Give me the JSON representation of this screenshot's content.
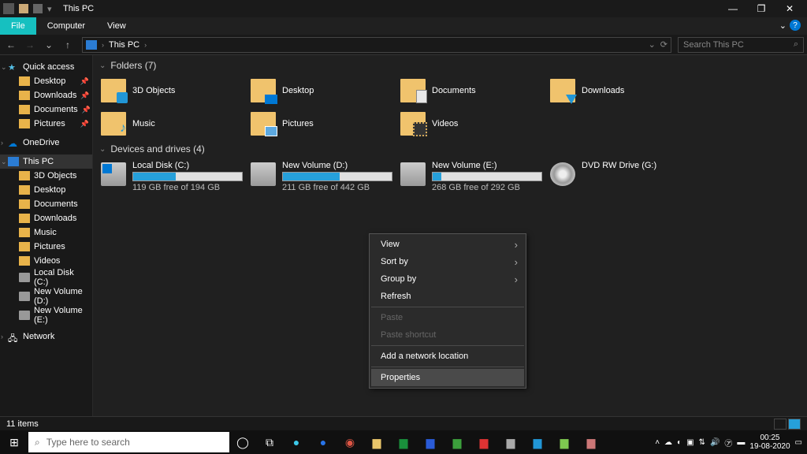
{
  "titlebar": {
    "title": "This PC",
    "min": "—",
    "max": "❐",
    "close": "✕"
  },
  "menubar": {
    "file": "File",
    "computer": "Computer",
    "view": "View",
    "help": "?",
    "expand": "⌄"
  },
  "navbar": {
    "back": "←",
    "forward": "→",
    "recent": "⌄",
    "up": "↑",
    "crumb_root": "This PC",
    "crumb_sep": "›",
    "refresh": "⟳",
    "addr_drop": "⌄",
    "search_placeholder": "Search This PC",
    "search_icon": "⌕"
  },
  "sidebar": {
    "quickaccess": "Quick access",
    "qa": [
      {
        "label": "Desktop",
        "pin": true
      },
      {
        "label": "Downloads",
        "pin": true
      },
      {
        "label": "Documents",
        "pin": true
      },
      {
        "label": "Pictures",
        "pin": true
      }
    ],
    "onedrive": "OneDrive",
    "thispc": "This PC",
    "pc": [
      {
        "label": "3D Objects"
      },
      {
        "label": "Desktop"
      },
      {
        "label": "Documents"
      },
      {
        "label": "Downloads"
      },
      {
        "label": "Music"
      },
      {
        "label": "Pictures"
      },
      {
        "label": "Videos"
      },
      {
        "label": "Local Disk (C:)"
      },
      {
        "label": "New Volume (D:)"
      },
      {
        "label": "New Volume (E:)"
      }
    ],
    "network": "Network"
  },
  "content": {
    "group_folders": "Folders (7)",
    "folders": [
      {
        "name": "3D Objects",
        "cls": "obj"
      },
      {
        "name": "Desktop",
        "cls": "desk"
      },
      {
        "name": "Documents",
        "cls": "docs"
      },
      {
        "name": "Downloads",
        "cls": "down"
      },
      {
        "name": "Music",
        "cls": "music"
      },
      {
        "name": "Pictures",
        "cls": "pics"
      },
      {
        "name": "Videos",
        "cls": "vids"
      }
    ],
    "group_drives": "Devices and drives (4)",
    "drives": [
      {
        "name": "Local Disk (C:)",
        "free": "119 GB free of 194 GB",
        "pct": 39,
        "cls": "win"
      },
      {
        "name": "New Volume (D:)",
        "free": "211 GB free of 442 GB",
        "pct": 52,
        "cls": ""
      },
      {
        "name": "New Volume (E:)",
        "free": "268 GB free of 292 GB",
        "pct": 8,
        "cls": ""
      },
      {
        "name": "DVD RW Drive (G:)",
        "free": "",
        "pct": -1,
        "cls": "dvd"
      }
    ]
  },
  "contextmenu": {
    "view": "View",
    "sortby": "Sort by",
    "groupby": "Group by",
    "refresh": "Refresh",
    "paste": "Paste",
    "paste_shortcut": "Paste shortcut",
    "add_network": "Add a network location",
    "properties": "Properties"
  },
  "statusbar": {
    "count": "11 items"
  },
  "taskbar": {
    "start": "⊞",
    "search": "Type here to search",
    "cortana": "◯",
    "taskview": "⧉",
    "tray_up": "˄",
    "clock_time": "00:25",
    "clock_date": "19-08-2020",
    "notify": "▭"
  }
}
